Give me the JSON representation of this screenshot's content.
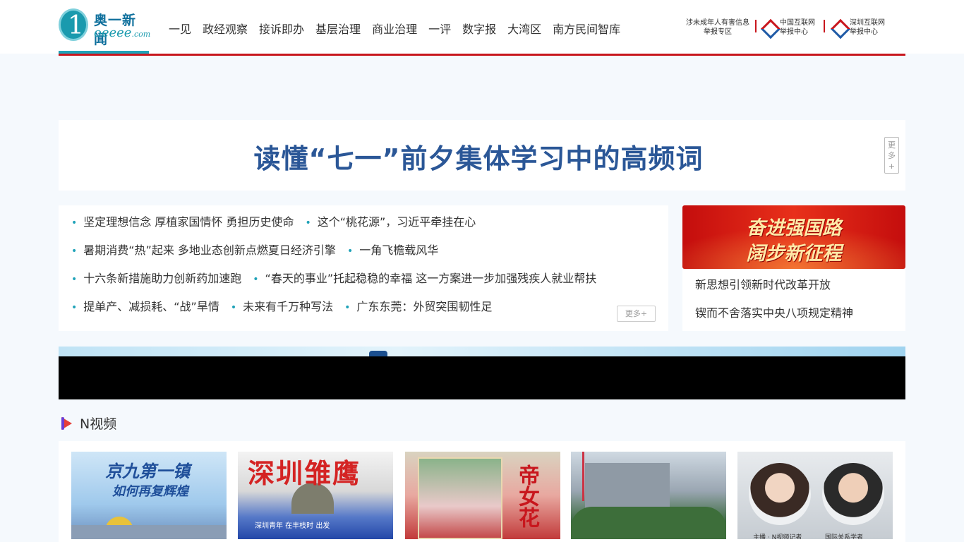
{
  "header": {
    "logo_cn": "奥一新闻",
    "logo_en": "oeeee",
    "logo_en_suffix": ".com",
    "nav": [
      "一见",
      "政经观察",
      "接诉即办",
      "基层治理",
      "商业治理",
      "一评",
      "数字报",
      "大湾区",
      "南方民间智库"
    ],
    "report_minors_line1": "涉未成年人有害信息",
    "report_minors_line2": "举报专区",
    "report_china_line1": "中国互联网",
    "report_china_line2": "举报中心",
    "report_shenzhen_line1": "深圳互联网",
    "report_shenzhen_line2": "举报中心",
    "accent_color": "#c8161d"
  },
  "headline": {
    "title": "读懂“七一”前夕集体学习中的高频词",
    "more_chars": [
      "更",
      "多",
      "+"
    ]
  },
  "news": {
    "rows": [
      [
        "坚定理想信念 厚植家国情怀 勇担历史使命",
        "这个“桃花源”，习近平牵挂在心"
      ],
      [
        "暑期消费“热”起来 多地业态创新点燃夏日经济引擎",
        "一角飞檐载风华"
      ],
      [
        "十六条新措施助力创新药加速跑",
        "“春天的事业”托起稳稳的幸福 这一方案进一步加强残疾人就业帮扶"
      ],
      [
        "提单产、减损耗、“战”旱情",
        "未来有千万种写法",
        "广东东莞：外贸突围韧性足"
      ]
    ],
    "more_label": "更多+"
  },
  "promo": {
    "banner_line1": "奋进强国路",
    "banner_line2": "阔步新征程",
    "links": [
      "新思想引领新时代改革开放",
      "锲而不舍落实中央八项规定精神"
    ]
  },
  "video_section": {
    "title": "N视频",
    "cards": [
      {
        "title1": "京九第一镇",
        "title2": "如何再复辉煌"
      },
      {
        "title1": "深圳雏鹰",
        "sub": "深圳青年 在丰枝时 出发"
      },
      {
        "title1": "帝女花"
      },
      {},
      {
        "cap1": "主播 · N视频记者",
        "cap2": "国际关系学者"
      }
    ]
  }
}
